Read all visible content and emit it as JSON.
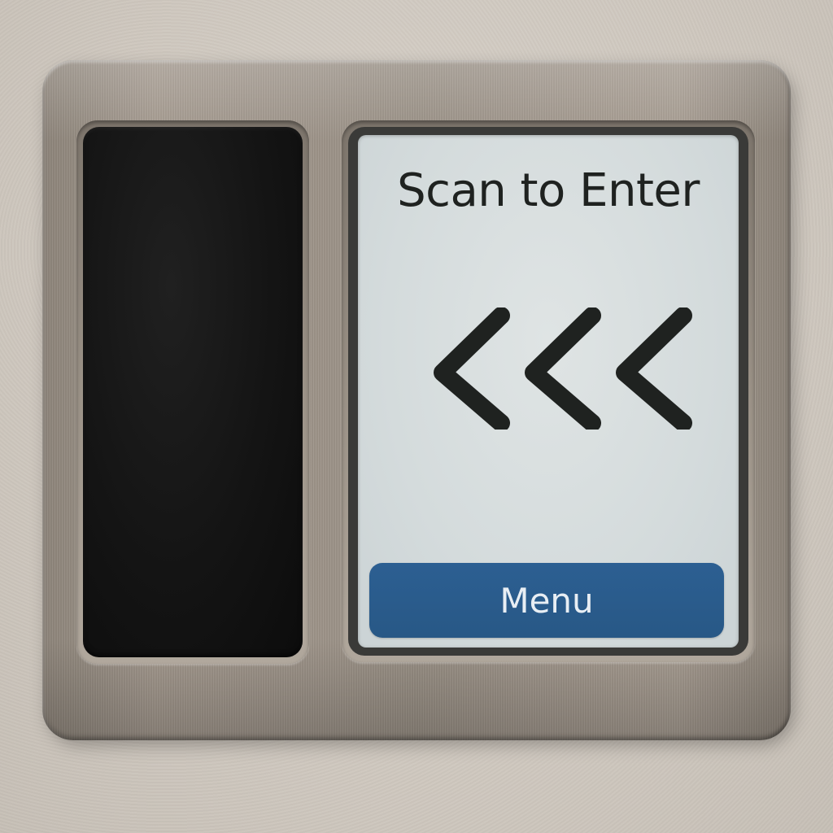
{
  "screen": {
    "title": "Scan to Enter",
    "direction_icon": "triple-chevron-left-icon",
    "menu_button_label": "Menu"
  },
  "colors": {
    "screen_background": "#d7dddd",
    "title_text": "#1f2220",
    "chevron_stroke": "#1f2220",
    "menu_button": "#2b5d8f",
    "menu_text": "#e8eef4",
    "reader_pad": "#141414",
    "plate_metal": "#9c9388",
    "wall": "#d4cdc4"
  }
}
